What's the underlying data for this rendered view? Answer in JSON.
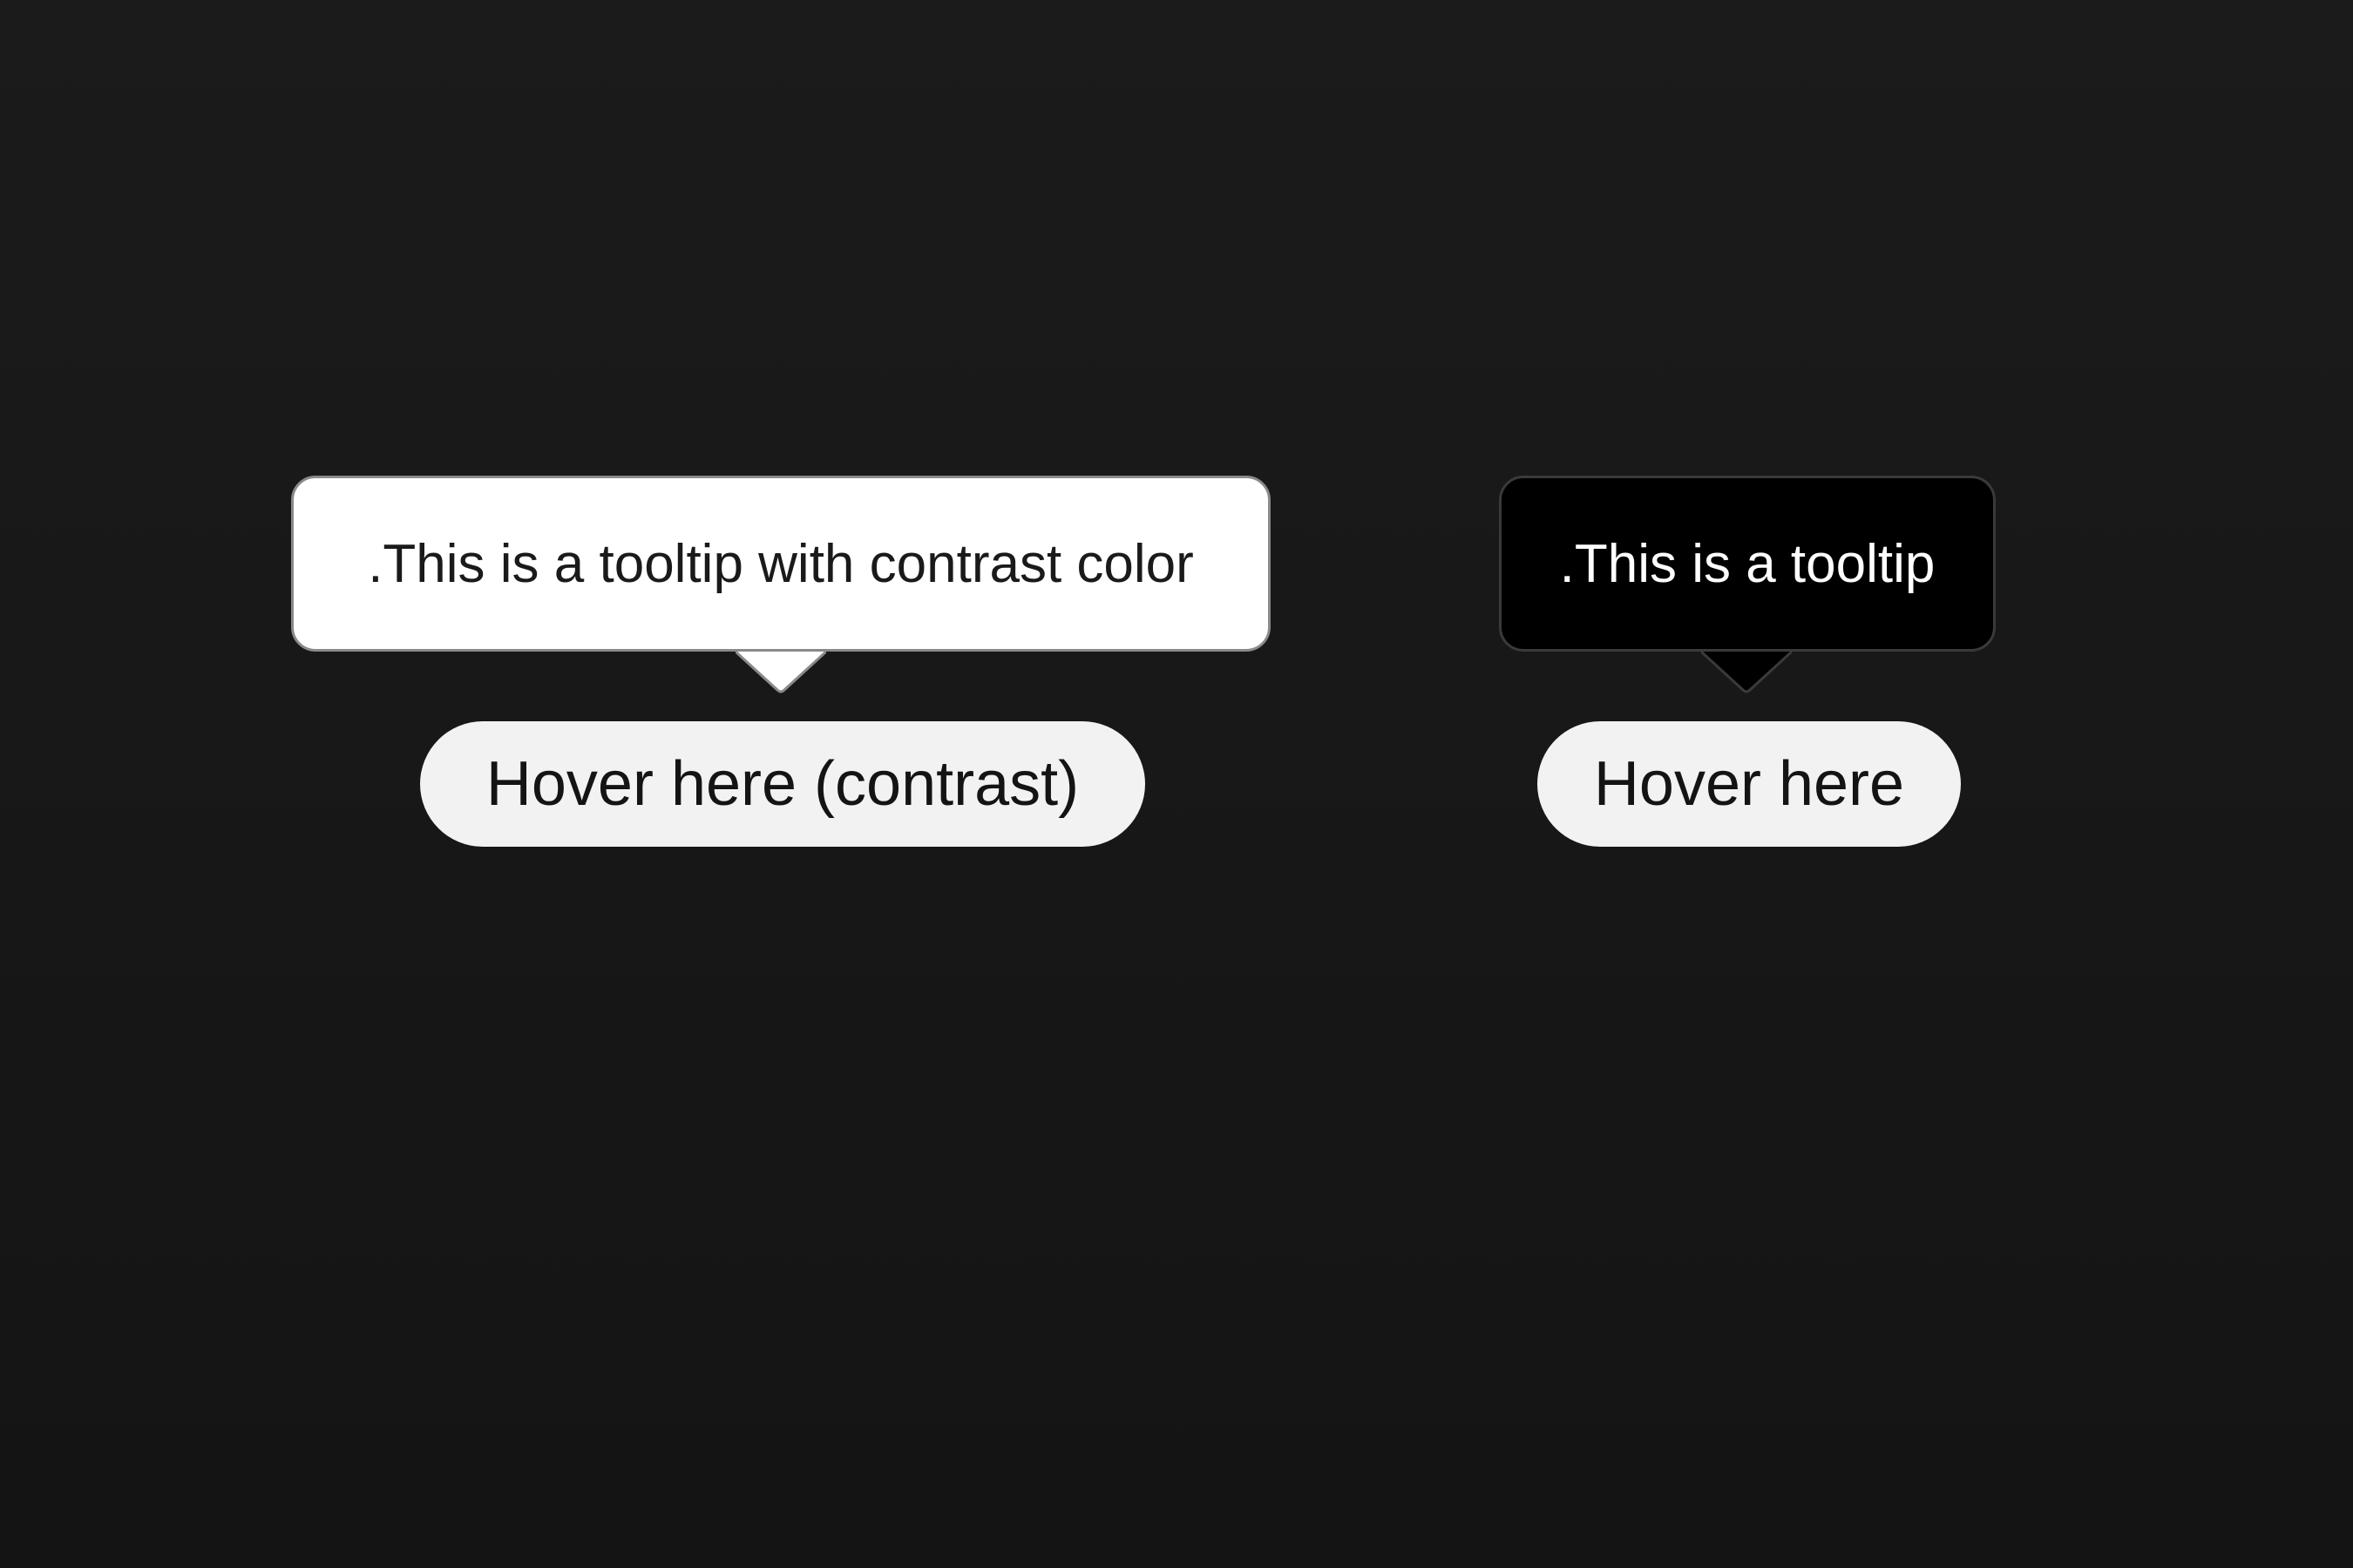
{
  "colors": {
    "background": "#181818",
    "tooltip_contrast_bg": "#ffffff",
    "tooltip_contrast_text": "#1a1a1a",
    "tooltip_default_bg": "#000000",
    "tooltip_default_text": "#ffffff",
    "button_bg": "#f2f2f2",
    "button_text": "#141414"
  },
  "demos": {
    "contrast": {
      "tooltip_text": ".This is a tooltip with contrast color",
      "button_label": "Hover here (contrast)"
    },
    "default": {
      "tooltip_text": ".This is a tooltip",
      "button_label": "Hover here"
    }
  }
}
